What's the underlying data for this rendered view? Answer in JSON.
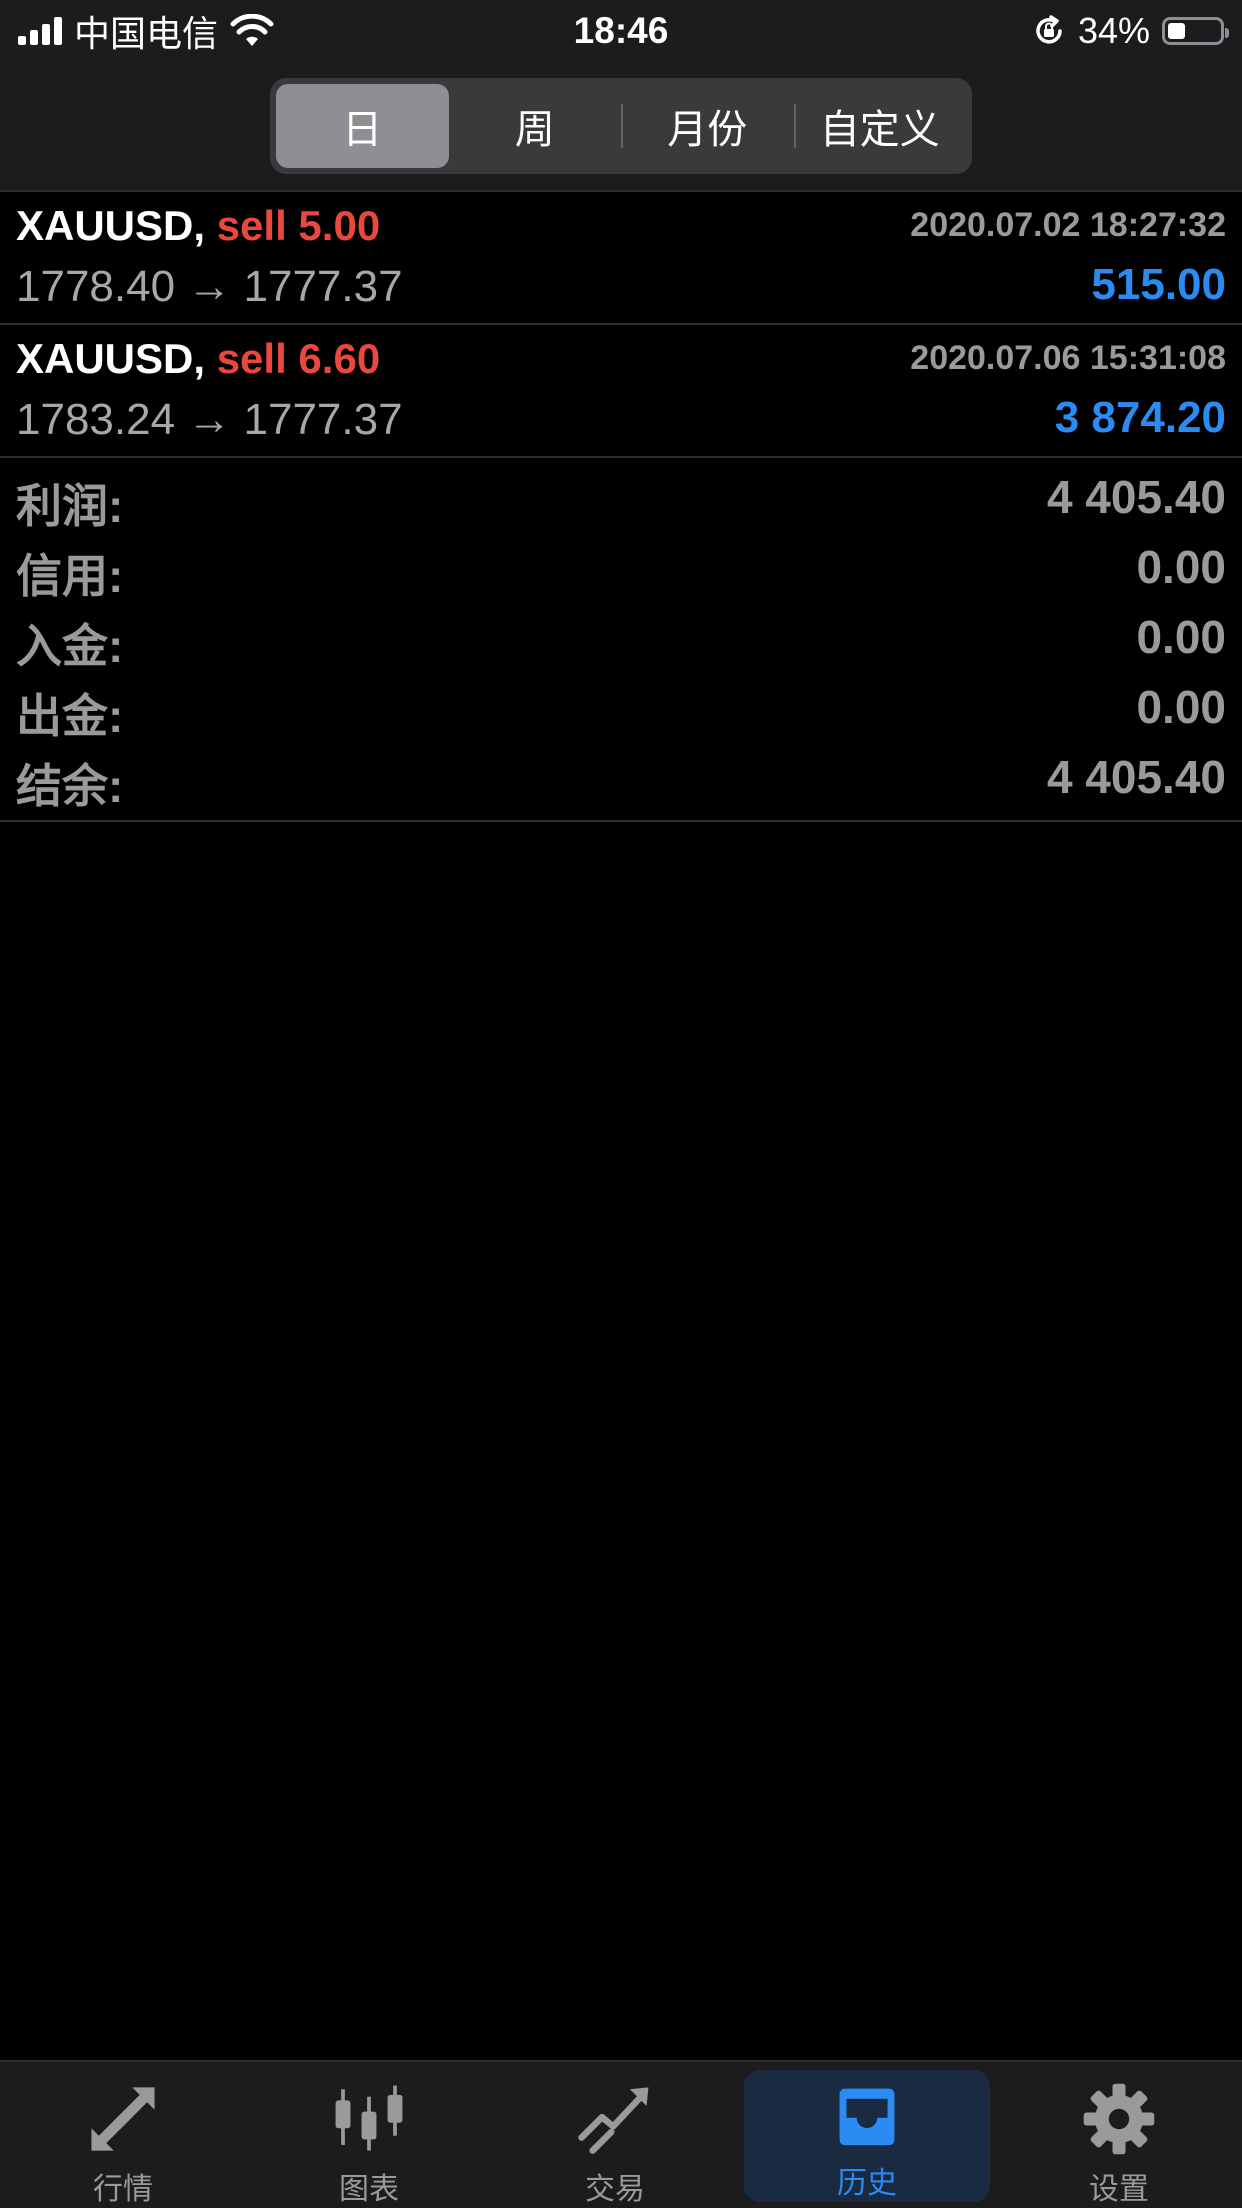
{
  "status_bar": {
    "carrier": "中国电信",
    "time": "18:46",
    "battery": "34%",
    "battery_level": 0.34
  },
  "periods": {
    "tabs": [
      {
        "label": "日",
        "active": true
      },
      {
        "label": "周",
        "active": false
      },
      {
        "label": "月份",
        "active": false
      },
      {
        "label": "自定义",
        "active": false
      }
    ]
  },
  "deals": [
    {
      "symbol": "XAUUSD,",
      "type": "sell 5.00",
      "time": "2020.07.02 18:27:32",
      "prices": "1778.40 → 1777.37",
      "profit": "515.00"
    },
    {
      "symbol": "XAUUSD,",
      "type": "sell 6.60",
      "time": "2020.07.06 15:31:08",
      "prices": "1783.24 → 1777.37",
      "profit": "3 874.20"
    }
  ],
  "summary": [
    {
      "label": "利润:",
      "value": "4 405.40"
    },
    {
      "label": "信用:",
      "value": "0.00"
    },
    {
      "label": "入金:",
      "value": "0.00"
    },
    {
      "label": "出金:",
      "value": "0.00"
    },
    {
      "label": "结余:",
      "value": "4 405.40"
    }
  ],
  "tabbar": {
    "items": [
      {
        "label": "行情",
        "icon": "quotes-arrows-icon",
        "active": false
      },
      {
        "label": "图表",
        "icon": "candlestick-chart-icon",
        "active": false
      },
      {
        "label": "交易",
        "icon": "trade-trend-icon",
        "active": false
      },
      {
        "label": "历史",
        "icon": "history-tray-icon",
        "active": true
      },
      {
        "label": "设置",
        "icon": "gear-icon",
        "active": false
      }
    ]
  },
  "colors": {
    "sell": "#e8483e",
    "profit": "#2a8bf2",
    "muted": "#9a9a9a",
    "background": "#000000",
    "bar": "#1c1c1e"
  }
}
